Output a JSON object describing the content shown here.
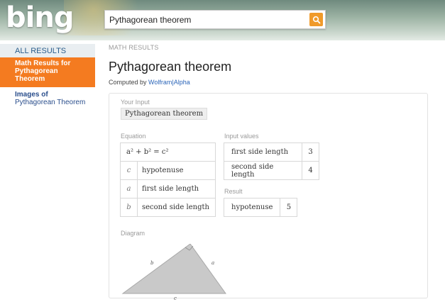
{
  "header": {
    "logo": "bing",
    "search_value": "Pythagorean theorem"
  },
  "sidebar": {
    "all_results": "ALL RESULTS",
    "active_line1": "Math Results for",
    "active_line2": "Pythagorean",
    "active_line3": "Theorem",
    "images_line1": "Images of",
    "images_line2": "Pythagorean Theorem"
  },
  "main": {
    "crumb": "MATH RESULTS",
    "title": "Pythagorean theorem",
    "computed_prefix": "Computed by ",
    "computed_link": "Wolfram|Alpha"
  },
  "pod": {
    "your_input_label": "Your Input",
    "your_input_value": "Pythagorean theorem",
    "equation_label": "Equation",
    "equation": "a² + b² = c²",
    "equation_rows": [
      {
        "sym": "c",
        "desc": "hypotenuse"
      },
      {
        "sym": "a",
        "desc": "first side length"
      },
      {
        "sym": "b",
        "desc": "second side length"
      }
    ],
    "input_values_label": "Input values",
    "input_values": [
      {
        "name": "first side length",
        "value": "3"
      },
      {
        "name": "second side length",
        "value": "4"
      }
    ],
    "result_label": "Result",
    "result": {
      "name": "hypotenuse",
      "value": "5"
    },
    "diagram_label": "Diagram",
    "diagram_labels": {
      "a": "a",
      "b": "b",
      "c": "c"
    }
  },
  "colors": {
    "accent": "#f47b20",
    "link": "#2a64b8",
    "search_button": "#f09a2a"
  },
  "icons": {
    "search": "magnifier-icon"
  }
}
